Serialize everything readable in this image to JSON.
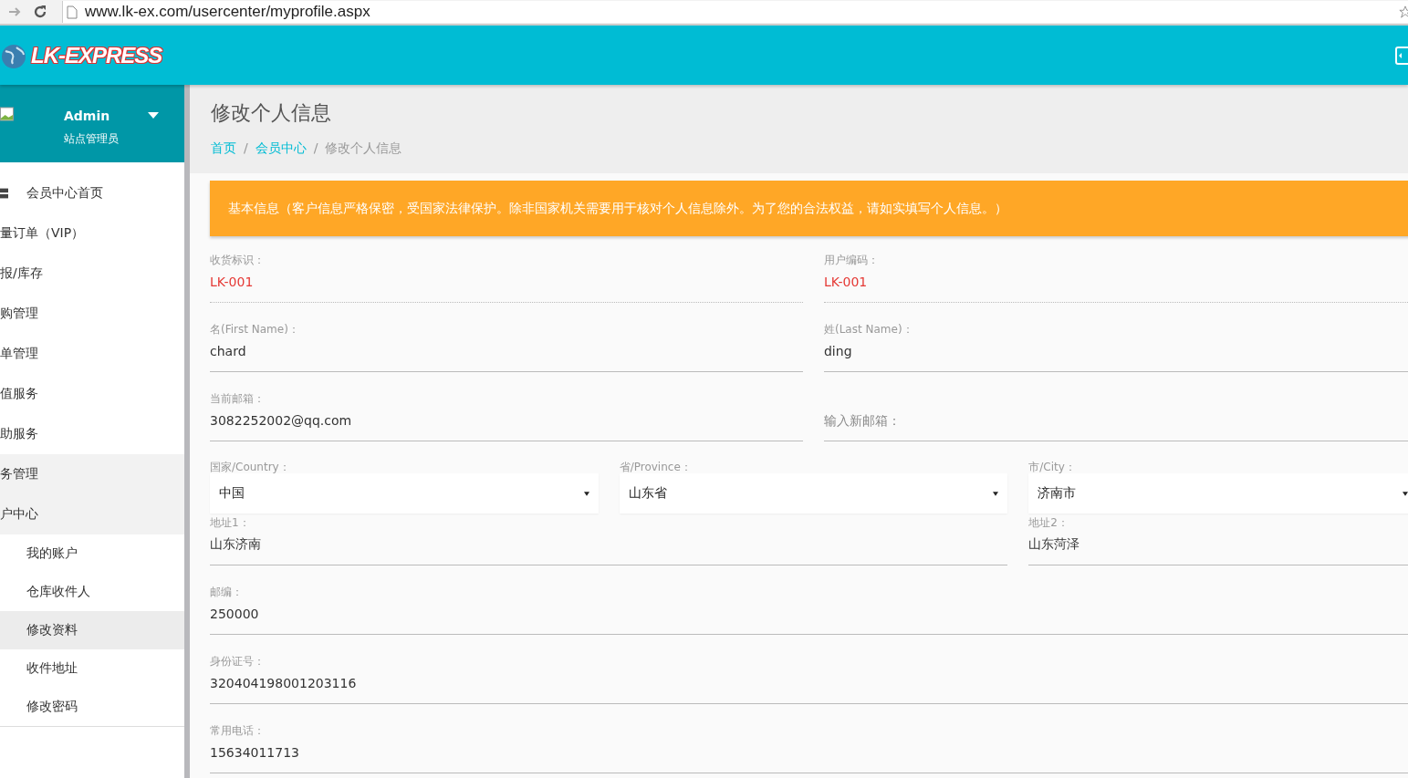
{
  "browser": {
    "url": "www.lk-ex.com/usercenter/myprofile.aspx"
  },
  "header": {
    "logo_text": "LK-EXPRESS"
  },
  "profile": {
    "name": "Admin",
    "role": "站点管理员"
  },
  "sidebar": {
    "items": [
      {
        "label": "会员中心首页",
        "icon": true,
        "active": false
      },
      {
        "label": "量订单（VIP）",
        "icon": false,
        "active": false
      },
      {
        "label": "报/库存",
        "icon": false,
        "active": false
      },
      {
        "label": "购管理",
        "icon": false,
        "active": false
      },
      {
        "label": "单管理",
        "icon": false,
        "active": false
      },
      {
        "label": "值服务",
        "icon": false,
        "active": false
      },
      {
        "label": "助服务",
        "icon": false,
        "active": false
      },
      {
        "label": "务管理",
        "icon": false,
        "active": true
      },
      {
        "label": "户中心",
        "icon": false,
        "active": true,
        "children": [
          {
            "label": "我的账户",
            "selected": false
          },
          {
            "label": "仓库收件人",
            "selected": false
          },
          {
            "label": "修改资料",
            "selected": true
          },
          {
            "label": "收件地址",
            "selected": false
          },
          {
            "label": "修改密码",
            "selected": false
          }
        ]
      }
    ]
  },
  "page": {
    "title": "修改个人信息",
    "breadcrumb": [
      {
        "label": "首页",
        "link": true
      },
      {
        "separator": "/",
        "label": "会员中心",
        "link": true
      },
      {
        "separator": "/",
        "label": "修改个人信息",
        "link": false
      }
    ]
  },
  "notice": "基本信息（客户信息严格保密，受国家法律保护。除非国家机关需要用于核对个人信息除外。为了您的合法权益，请如实填写个人信息。）",
  "form": {
    "rows": [
      {
        "fields": [
          {
            "kind": "readonly",
            "label": "收货标识：",
            "value": "LK-001"
          },
          {
            "kind": "readonly",
            "label": "用户编码：",
            "value": "LK-001"
          }
        ]
      },
      {
        "fields": [
          {
            "kind": "input",
            "label": "名(First Name)：",
            "value": "chard"
          },
          {
            "kind": "input",
            "label": "姓(Last Name)：",
            "value": "ding"
          }
        ]
      },
      {
        "fields": [
          {
            "kind": "input",
            "label": "当前邮箱：",
            "value": "3082252002@qq.com"
          },
          {
            "kind": "input",
            "placeholder": "输入新邮箱："
          }
        ]
      },
      {
        "fields": [
          {
            "kind": "select",
            "label": "国家/Country：",
            "value": "中国"
          },
          {
            "kind": "select",
            "label": "省/Province：",
            "value": "山东省"
          },
          {
            "kind": "select",
            "label": "市/City：",
            "value": "济南市"
          }
        ]
      },
      {
        "fields": [
          {
            "kind": "wide-input",
            "label": "地址1：",
            "value": "山东济南"
          },
          {
            "kind": "input",
            "label": "地址2：",
            "value": "山东菏泽"
          }
        ]
      },
      {
        "fields": [
          {
            "kind": "input",
            "label": "邮编：",
            "value": "250000"
          }
        ]
      },
      {
        "fields": [
          {
            "kind": "input",
            "label": "身份证号：",
            "value": "320404198001203116"
          }
        ]
      },
      {
        "fields": [
          {
            "kind": "input",
            "label": "常用电话：",
            "value": "15634011713"
          }
        ]
      }
    ]
  }
}
